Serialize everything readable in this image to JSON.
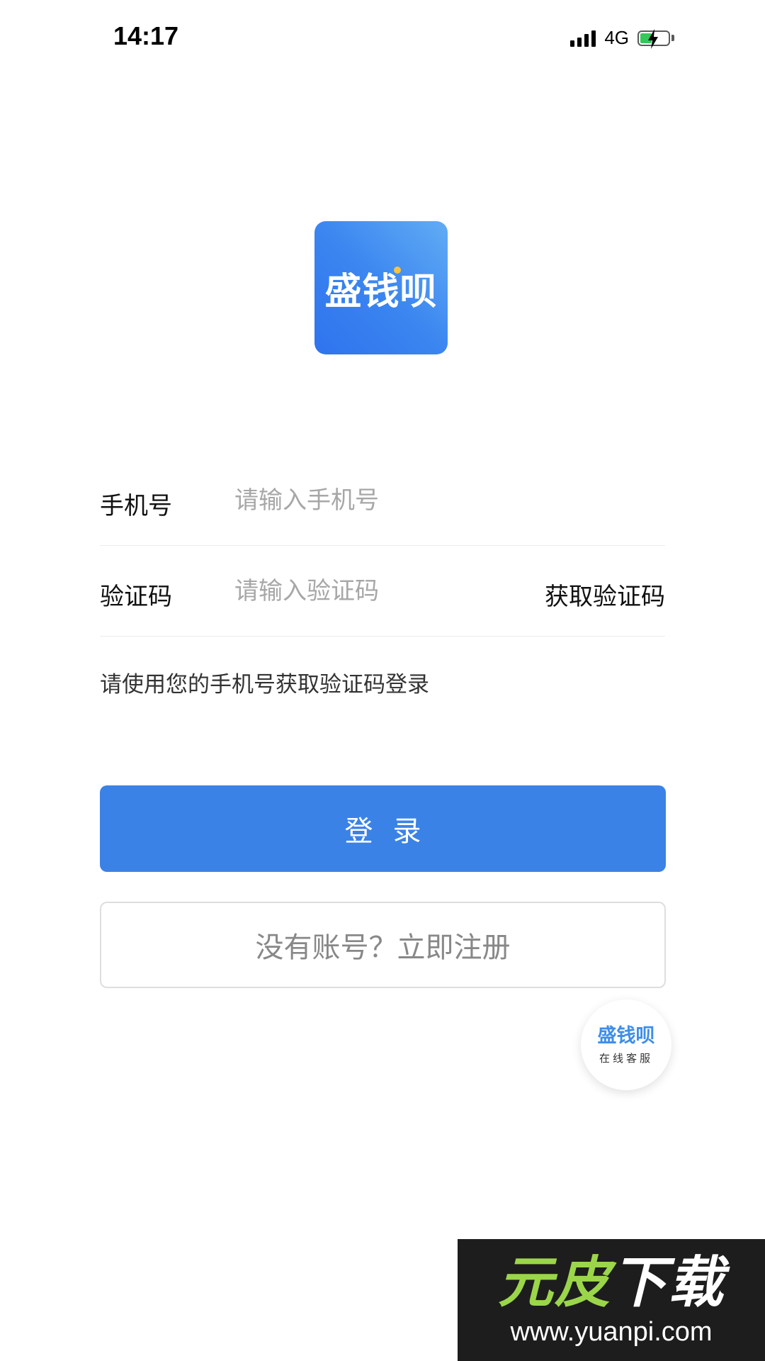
{
  "status_bar": {
    "time": "14:17",
    "network": "4G",
    "icons": [
      "signal-bars-icon",
      "battery-charging-icon"
    ]
  },
  "app": {
    "logo_text": "盛钱呗",
    "accent_color": "#3b82e6"
  },
  "form": {
    "phone": {
      "label": "手机号",
      "placeholder": "请输入手机号",
      "value": ""
    },
    "code": {
      "label": "验证码",
      "placeholder": "请输入验证码",
      "value": "",
      "get_code_label": "获取验证码"
    },
    "hint": "请使用您的手机号获取验证码登录"
  },
  "buttons": {
    "login_label": "登录",
    "register_label": "没有账号？立即注册"
  },
  "service": {
    "brand": "盛钱呗",
    "label": "在线客服"
  },
  "watermark": {
    "logo_text": "元皮下载",
    "url": "www.yuanpi.com"
  }
}
